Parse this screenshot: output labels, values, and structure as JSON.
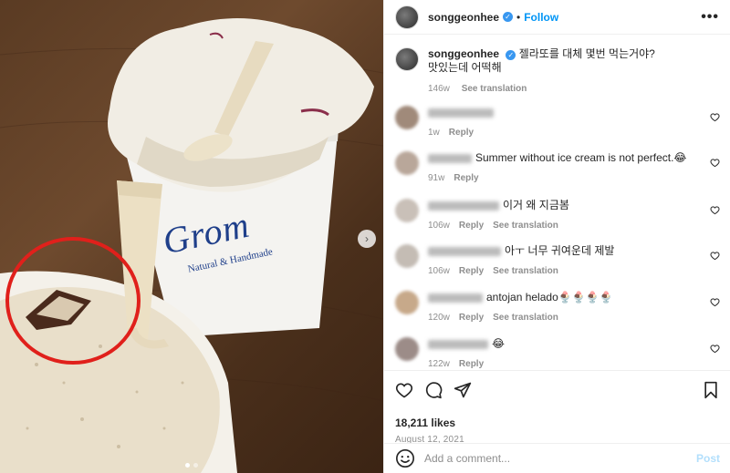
{
  "post": {
    "username": "songgeonhee",
    "follow_label": "Follow",
    "separator": "•",
    "more_label": "•••",
    "verified_mark": "✓"
  },
  "photo": {
    "cup_brand": "Grom",
    "cup_tagline": "Natural & Handmade",
    "carousel_count": 2,
    "active_index": 0
  },
  "caption": {
    "username": "songgeonhee",
    "text_line1": "젤라또를 대체 몇번 먹는거야?",
    "text_line2": "맛있는데 어떡해",
    "time": "146w",
    "translate_label": "See translation"
  },
  "comments": [
    {
      "text": "",
      "time": "1w",
      "reply": "Reply",
      "translate": "",
      "avatar_color": "#a08a7a",
      "name_width": 72
    },
    {
      "text": "Summer without ice cream is not perfect.😂",
      "time": "91w",
      "reply": "Reply",
      "translate": "",
      "avatar_color": "#b9a79a",
      "name_width": 48
    },
    {
      "text": "이거 왜 지금봄",
      "time": "106w",
      "reply": "Reply",
      "translate": "See translation",
      "avatar_color": "#c9c0b8",
      "name_width": 78
    },
    {
      "text": "아ㅜ 너무 귀여운데 제발",
      "time": "106w",
      "reply": "Reply",
      "translate": "See translation",
      "avatar_color": "#c4bcb4",
      "name_width": 80
    },
    {
      "text": "antojan helado🍨🍨🍨🍨",
      "time": "120w",
      "reply": "Reply",
      "translate": "See translation",
      "avatar_color": "#c7a98a",
      "name_width": 60
    },
    {
      "text": "😂",
      "time": "122w",
      "reply": "Reply",
      "translate": "",
      "avatar_color": "#9c8c88",
      "name_width": 66
    }
  ],
  "stats": {
    "likes": "18,211 likes",
    "date": "August 12, 2021"
  },
  "add_comment": {
    "placeholder": "Add a comment...",
    "post_label": "Post"
  },
  "colors": {
    "accent": "#0095f6",
    "verified": "#3897f0",
    "highlight_circle": "#e0201b"
  }
}
